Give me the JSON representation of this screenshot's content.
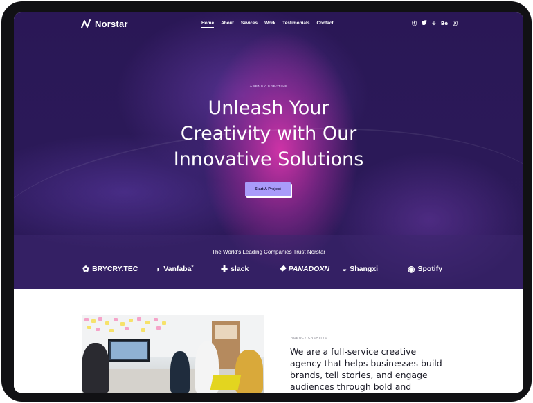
{
  "brand": {
    "name": "Norstar"
  },
  "nav": {
    "items": [
      {
        "label": "Home",
        "active": true
      },
      {
        "label": "About"
      },
      {
        "label": "Sevices"
      },
      {
        "label": "Work"
      },
      {
        "label": "Testimonials"
      },
      {
        "label": "Contact"
      }
    ]
  },
  "social": {
    "icons": [
      {
        "name": "facebook-icon",
        "glyph": "ⓕ"
      },
      {
        "name": "twitter-icon",
        "glyph": "🐦"
      },
      {
        "name": "dribbble-icon",
        "glyph": "⊛"
      },
      {
        "name": "behance-icon",
        "glyph": "Bē"
      },
      {
        "name": "pinterest-icon",
        "glyph": "ⓟ"
      }
    ]
  },
  "hero": {
    "eyebrow": "AGENCY CREATIVE",
    "headline_lines": [
      "Unleash Your",
      "Creativity with Our",
      "Innovative Solutions"
    ],
    "cta_label": "Start A Project"
  },
  "trust": {
    "title": "The World's Leading Companies Trust Norstar",
    "logos": [
      {
        "name": "BRYCRY.TEC",
        "glyph": "✿"
      },
      {
        "name": "Vanfaba˚",
        "glyph": "◗"
      },
      {
        "name": "slack",
        "glyph": "✚"
      },
      {
        "name": "PANADOXN",
        "glyph": "⯁"
      },
      {
        "name": "Shangxi",
        "glyph": "◒"
      },
      {
        "name": "Spotify",
        "glyph": "◉"
      }
    ]
  },
  "about": {
    "eyebrow": "AGENCY CREATIVE",
    "text_lines": [
      "We are a full-service creative",
      "agency that helps businesses build",
      "brands, tell stories, and engage",
      "audiences through bold and"
    ]
  },
  "colors": {
    "hero_bg": "#2b1958",
    "accent_glow": "#d634aa",
    "cta_bg": "#a99bfa",
    "text_dark": "#1a1a26"
  }
}
